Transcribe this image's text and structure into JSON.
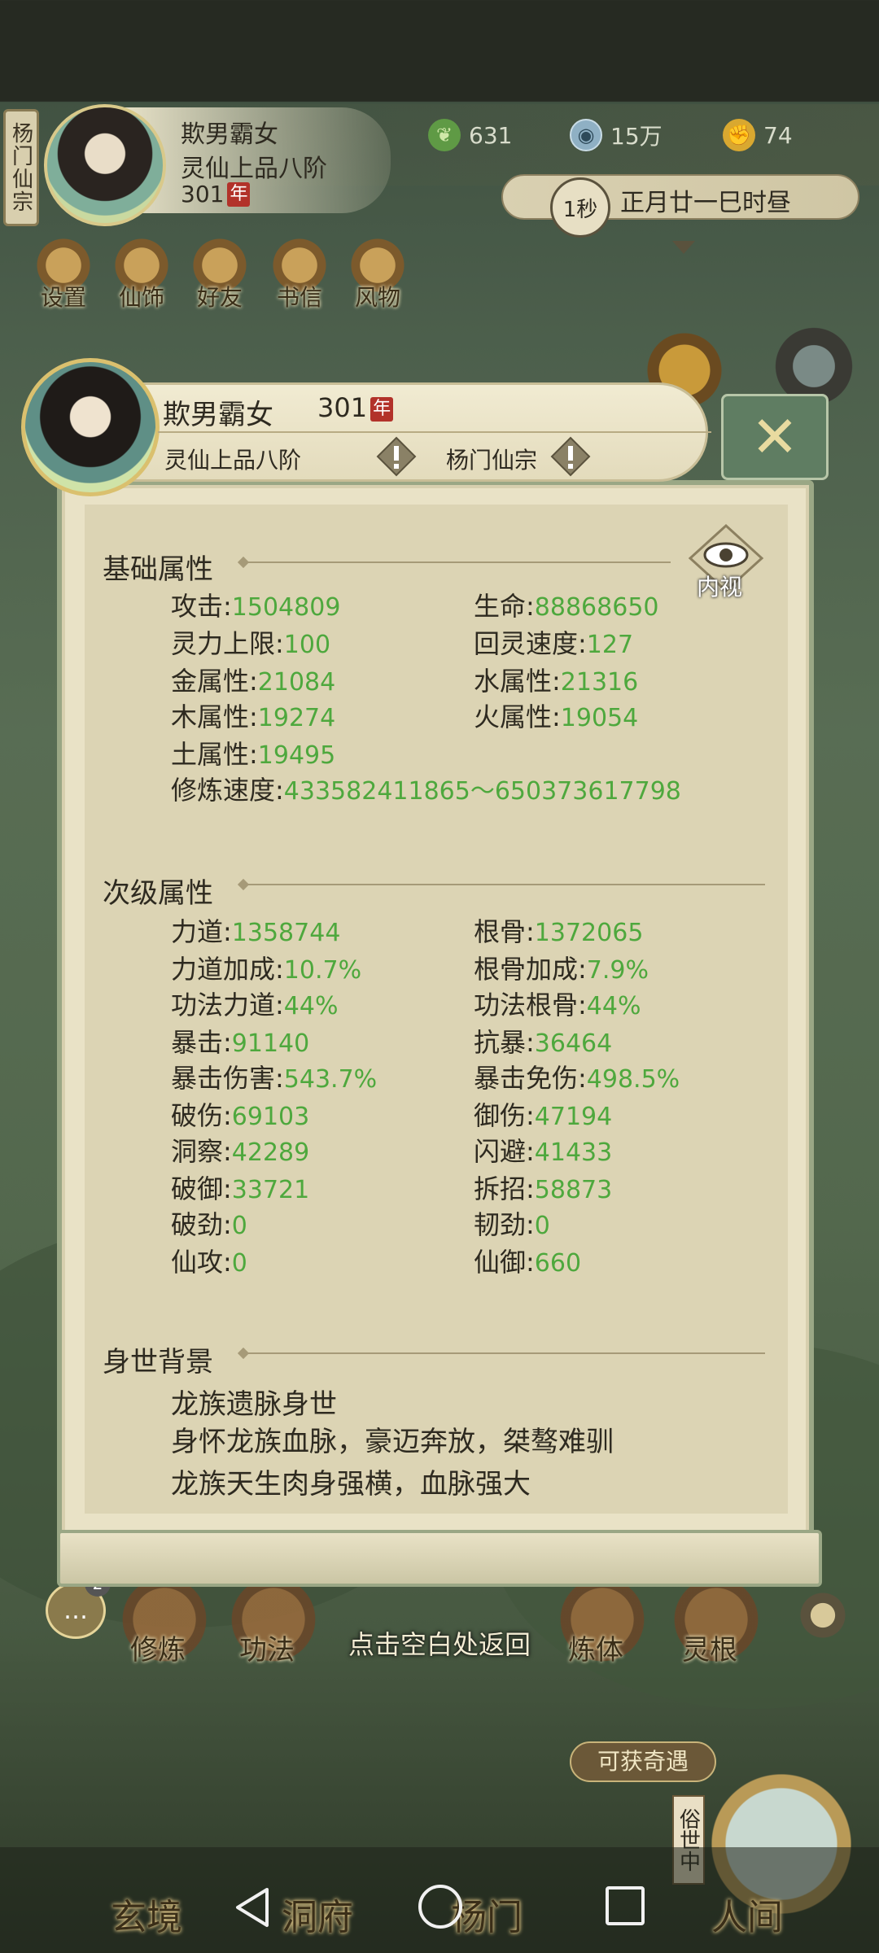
{
  "player": {
    "sect": "杨门仙宗",
    "name": "欺男霸女",
    "rank": "灵仙上品八阶",
    "age": "301",
    "age_unit": "年"
  },
  "resources": {
    "jade": "631",
    "coins": "15万",
    "strength": "74"
  },
  "time": {
    "speed": "1秒",
    "date": "正月廿一巳时昼"
  },
  "top_menu": [
    "设置",
    "仙饰",
    "好友",
    "书信",
    "风物"
  ],
  "modal": {
    "name": "欺男霸女",
    "age": "301",
    "age_unit": "年",
    "rank": "灵仙上品八阶",
    "sect": "杨门仙宗",
    "inner_view": "内视",
    "close_icon": "close-x-icon"
  },
  "basic": {
    "title": "基础属性",
    "rows": [
      {
        "l": "攻击",
        "lv": "1504809",
        "r": "生命",
        "rv": "88868650"
      },
      {
        "l": "灵力上限",
        "lv": "100",
        "r": "回灵速度",
        "rv": "127"
      },
      {
        "l": "金属性",
        "lv": "21084",
        "r": "水属性",
        "rv": "21316"
      },
      {
        "l": "木属性",
        "lv": "19274",
        "r": "火属性",
        "rv": "19054"
      },
      {
        "l": "土属性",
        "lv": "19495",
        "r": "",
        "rv": ""
      }
    ],
    "cultivation_label": "修炼速度",
    "cultivation_value": "433582411865～650373617798"
  },
  "secondary": {
    "title": "次级属性",
    "rows": [
      {
        "l": "力道",
        "lv": "1358744",
        "r": "根骨",
        "rv": "1372065"
      },
      {
        "l": "力道加成",
        "lv": "10.7%",
        "r": "根骨加成",
        "rv": "7.9%"
      },
      {
        "l": "功法力道",
        "lv": "44%",
        "r": "功法根骨",
        "rv": "44%"
      },
      {
        "l": "暴击",
        "lv": "91140",
        "r": "抗暴",
        "rv": "36464"
      },
      {
        "l": "暴击伤害",
        "lv": "543.7%",
        "r": "暴击免伤",
        "rv": "498.5%"
      },
      {
        "l": "破伤",
        "lv": "69103",
        "r": "御伤",
        "rv": "47194"
      },
      {
        "l": "洞察",
        "lv": "42289",
        "r": "闪避",
        "rv": "41433"
      },
      {
        "l": "破御",
        "lv": "33721",
        "r": "拆招",
        "rv": "58873"
      },
      {
        "l": "破劲",
        "lv": "0",
        "r": "韧劲",
        "rv": "0"
      },
      {
        "l": "仙攻",
        "lv": "0",
        "r": "仙御",
        "rv": "660"
      }
    ]
  },
  "background": {
    "title": "身世背景",
    "lines": [
      "龙族遗脉身世",
      "身怀龙族血脉，豪迈奔放，桀骜难驯",
      "龙族天生肉身强横，血脉强大"
    ]
  },
  "hint": "点击空白处返回",
  "bottom_menu": [
    "修炼",
    "功法",
    "",
    "",
    "炼体",
    "灵根"
  ],
  "chat_badge": "2",
  "adventure": "可获奇遇",
  "world_tag": "俗世中",
  "footer_tabs": [
    "玄境",
    "洞府",
    "杨门",
    "人间"
  ],
  "colors": {
    "value_green": "#4ea83d",
    "panel": "#e9e2c6",
    "accent_red": "#b2322a"
  }
}
